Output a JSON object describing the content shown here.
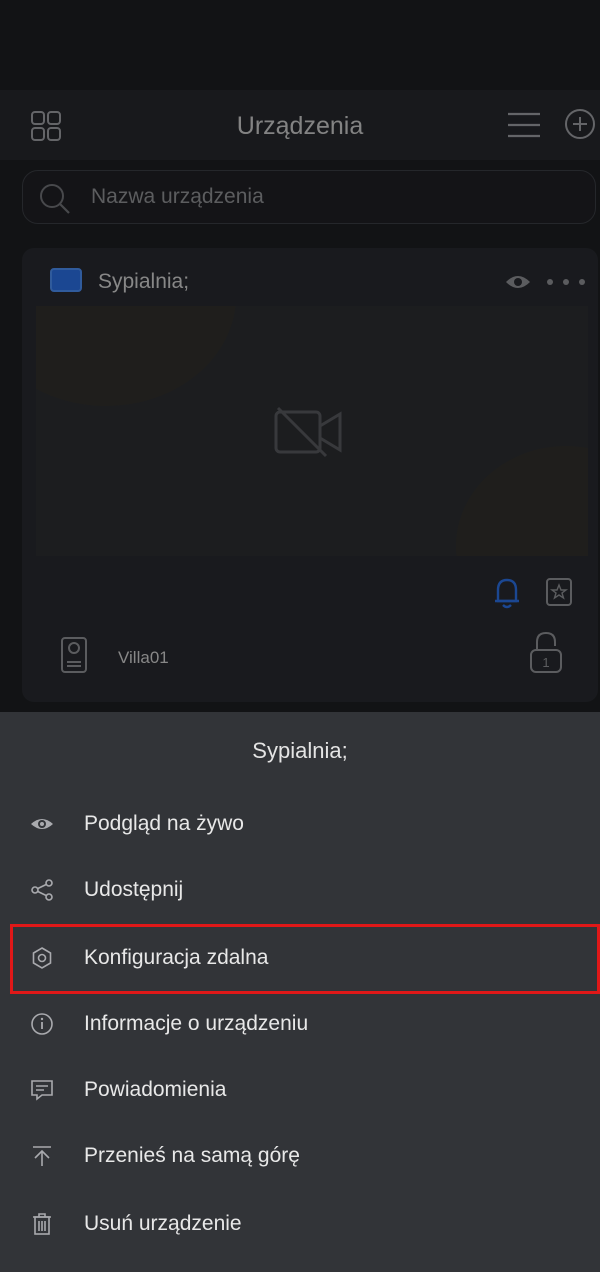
{
  "header": {
    "title": "Urządzenia"
  },
  "search": {
    "placeholder": "Nazwa urządzenia"
  },
  "device_card": {
    "name": "Sypialnia;",
    "door_station": "Villa01",
    "lock_number": "1"
  },
  "sheet": {
    "title": "Sypialnia;",
    "items": [
      {
        "label": "Podgląd na żywo",
        "icon": "eye-icon"
      },
      {
        "label": "Udostępnij",
        "icon": "share-icon"
      },
      {
        "label": "Konfiguracja zdalna",
        "icon": "gear-icon"
      },
      {
        "label": "Informacje o urządzeniu",
        "icon": "info-icon"
      },
      {
        "label": "Powiadomienia",
        "icon": "message-icon"
      },
      {
        "label": "Przenieś na samą górę",
        "icon": "move-top-icon"
      },
      {
        "label": "Usuń urządzenie",
        "icon": "trash-icon"
      }
    ]
  },
  "colors": {
    "highlight": "#e01818",
    "accent": "#2a6ee0"
  }
}
